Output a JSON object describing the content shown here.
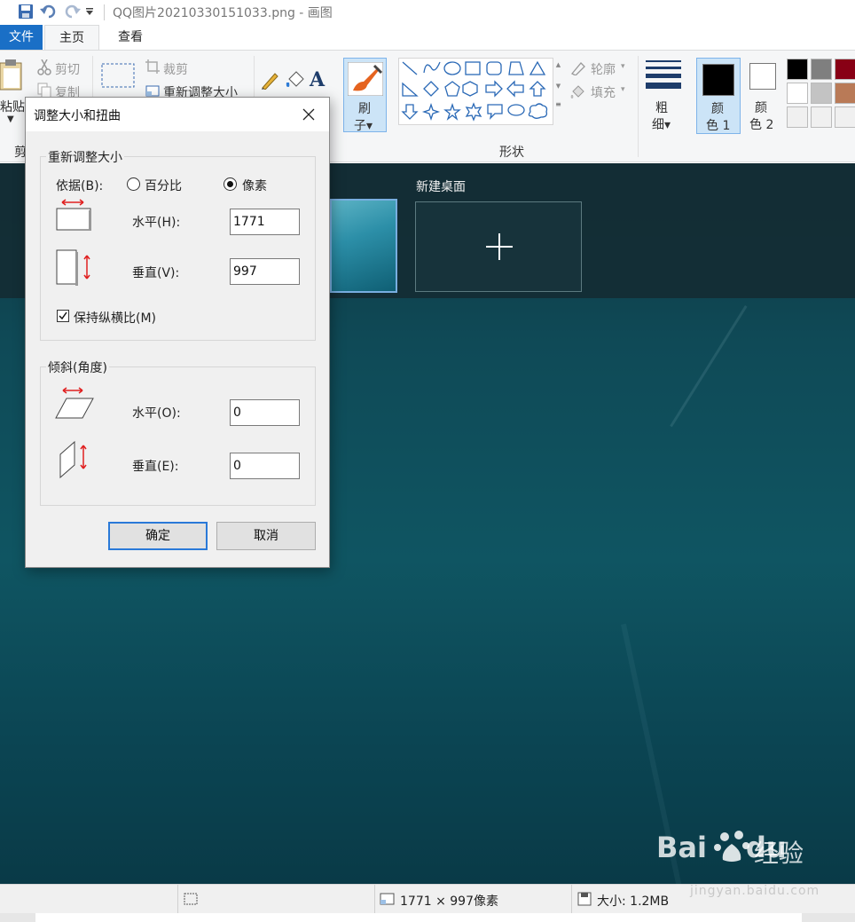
{
  "window": {
    "title": "QQ图片20210330151033.png - 画图"
  },
  "ribbon": {
    "tabs": [
      "文件",
      "主页",
      "查看"
    ],
    "clipboard": {
      "paste": "粘贴",
      "cut": "剪切",
      "copy": "复制",
      "group": "剪"
    },
    "image": {
      "crop": "裁剪",
      "resize": "重新调整大小"
    },
    "brush": {
      "line1": "刷",
      "line2": "子▾"
    },
    "shapes": {
      "outline": "轮廓",
      "fill": "填充",
      "group": "形状"
    },
    "size": {
      "line1": "粗",
      "line2": "细▾"
    },
    "color1": {
      "line1": "颜",
      "line2": "色 1"
    },
    "color2": {
      "line1": "颜",
      "line2": "色 2"
    },
    "palette": [
      "#000000",
      "#7f7f7f",
      "#880015",
      "#ffffff",
      "#c3c3c3",
      "#b97a57",
      "#f0f0f0",
      "#f0f0f0",
      "#f0f0f0"
    ]
  },
  "canvas": {
    "new_desktop_label": "新建桌面"
  },
  "dialog": {
    "title": "调整大小和扭曲",
    "resize_group": "重新调整大小",
    "by_label": "依据(B):",
    "percent_label": "百分比",
    "pixels_label": "像素",
    "selected_unit": "像素",
    "horizontal_label": "水平(H):",
    "horizontal_value": "1771",
    "vertical_label": "垂直(V):",
    "vertical_value": "997",
    "keep_ratio_label": "保持纵横比(M)",
    "keep_ratio_checked": true,
    "skew_group": "倾斜(角度)",
    "skew_horizontal_label": "水平(O):",
    "skew_horizontal_value": "0",
    "skew_vertical_label": "垂直(E):",
    "skew_vertical_value": "0",
    "ok_label": "确定",
    "cancel_label": "取消"
  },
  "statusbar": {
    "dimensions": "1771 × 997像素",
    "file_size": "大小: 1.2MB"
  },
  "watermark": {
    "logo": "Bai",
    "logo_end": "du",
    "text": "经验",
    "url": "jingyan.baidu.com"
  },
  "colors": {
    "accent": "#1a6fc6",
    "ok_border": "#2a79d8",
    "arrow_red": "#e02020"
  }
}
